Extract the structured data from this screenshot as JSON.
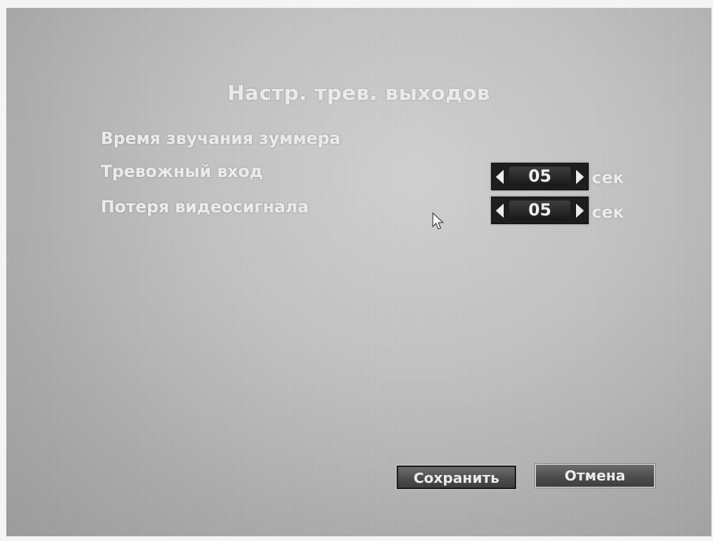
{
  "dialog": {
    "title": "Настр. трев. выходов"
  },
  "settings": [
    {
      "label": "Время звучания зуммера"
    },
    {
      "label": "Тревожный вход",
      "value": "05",
      "unit": "сек"
    },
    {
      "label": "Потеря видеосигнала",
      "value": "05",
      "unit": "сек"
    }
  ],
  "buttons": {
    "save_label": "Сохранить",
    "cancel_label": "Отмена"
  },
  "icons": {
    "decrement": "arrow-left-icon",
    "increment": "arrow-right-icon",
    "cursor": "mouse-pointer-icon"
  },
  "colors": {
    "background": "#c3c3c3",
    "text": "#efefef",
    "spinner_bg": "#1a1a1a"
  }
}
